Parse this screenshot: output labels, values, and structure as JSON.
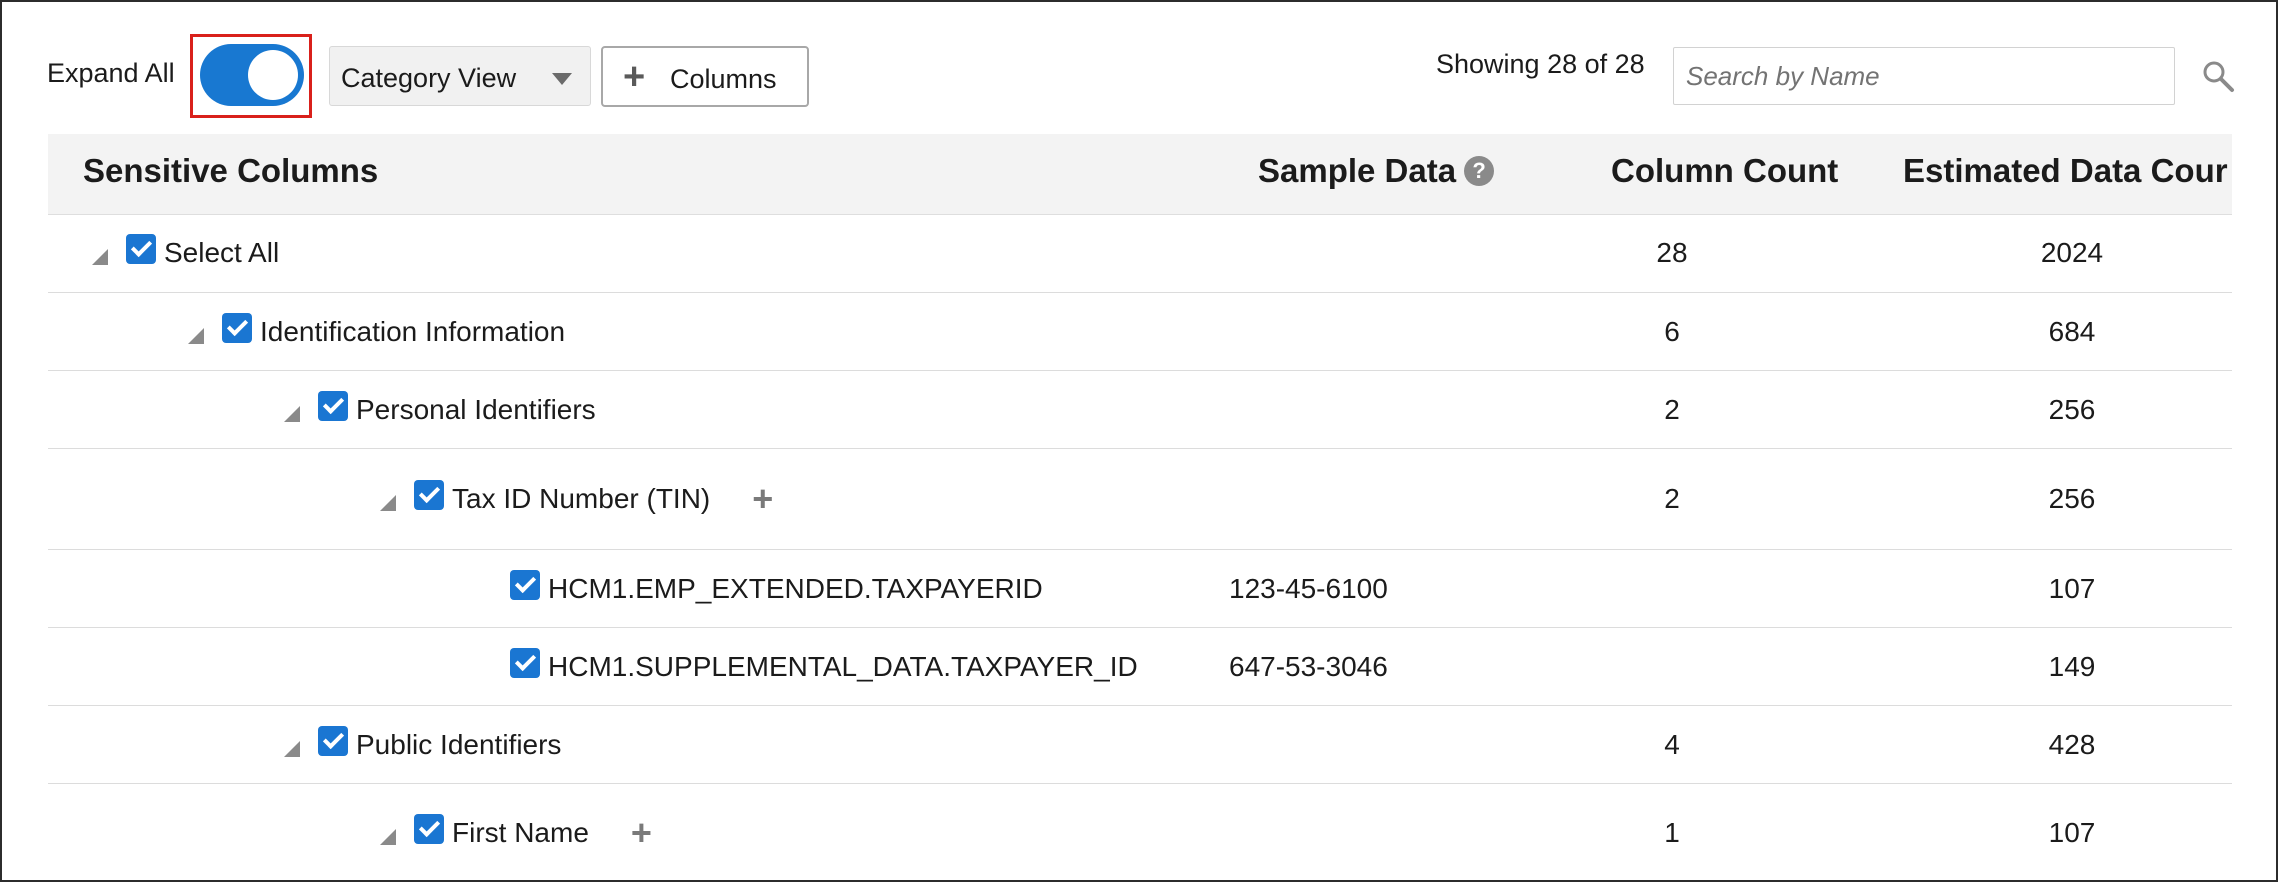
{
  "toolbar": {
    "expand_all_label": "Expand All",
    "expand_all_on": true,
    "view_select_value": "Category View",
    "columns_button_label": "Columns",
    "showing_text": "Showing 28 of 28",
    "search_placeholder": "Search by Name"
  },
  "colors": {
    "accent": "#1878d1",
    "highlight_box": "#d9201b",
    "header_bg": "#f3f3f3"
  },
  "table": {
    "headers": {
      "sensitive_columns": "Sensitive Columns",
      "sample_data": "Sample Data",
      "column_count": "Column Count",
      "estimated_data_count": "Estimated Data Cour"
    },
    "rows": [
      {
        "label": "Select All",
        "sample": "",
        "column_count": "28",
        "estimated": "2024",
        "checked": true
      },
      {
        "label": "Identification Information",
        "sample": "",
        "column_count": "6",
        "estimated": "684",
        "checked": true
      },
      {
        "label": "Personal Identifiers",
        "sample": "",
        "column_count": "2",
        "estimated": "256",
        "checked": true
      },
      {
        "label": "Tax ID Number (TIN)",
        "sample": "",
        "column_count": "2",
        "estimated": "256",
        "checked": true
      },
      {
        "label": "HCM1.EMP_EXTENDED.TAXPAYERID",
        "sample": "123-45-6100",
        "column_count": "",
        "estimated": "107",
        "checked": true
      },
      {
        "label": "HCM1.SUPPLEMENTAL_DATA.TAXPAYER_ID",
        "sample": "647-53-3046",
        "column_count": "",
        "estimated": "149",
        "checked": true
      },
      {
        "label": "Public Identifiers",
        "sample": "",
        "column_count": "4",
        "estimated": "428",
        "checked": true
      },
      {
        "label": "First Name",
        "sample": "",
        "column_count": "1",
        "estimated": "107",
        "checked": true
      }
    ]
  }
}
